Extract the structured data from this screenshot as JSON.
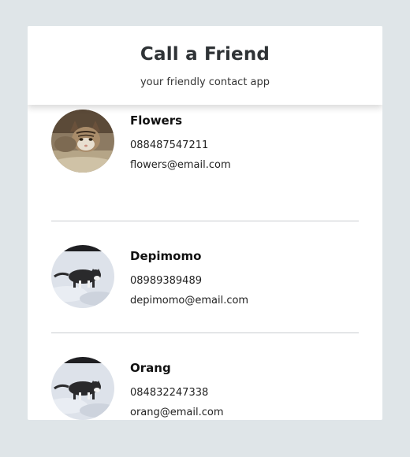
{
  "header": {
    "title": "Call a Friend",
    "subtitle": "your friendly contact app"
  },
  "contacts": [
    {
      "name": "Flowers",
      "phone": "088487547211",
      "email": "flowers@email.com",
      "avatar_icon": "tabby-kitten-photo"
    },
    {
      "name": "Depimomo",
      "phone": "08989389489",
      "email": "depimomo@email.com",
      "avatar_icon": "cat-in-snow-photo"
    },
    {
      "name": "Orang",
      "phone": "084832247338",
      "email": "orang@email.com",
      "avatar_icon": "cat-in-snow-photo"
    }
  ],
  "colors": {
    "page_background": "#dfe5e8",
    "card_background": "#ffffff",
    "divider": "#c9cccf",
    "title_text": "#2f3336"
  }
}
